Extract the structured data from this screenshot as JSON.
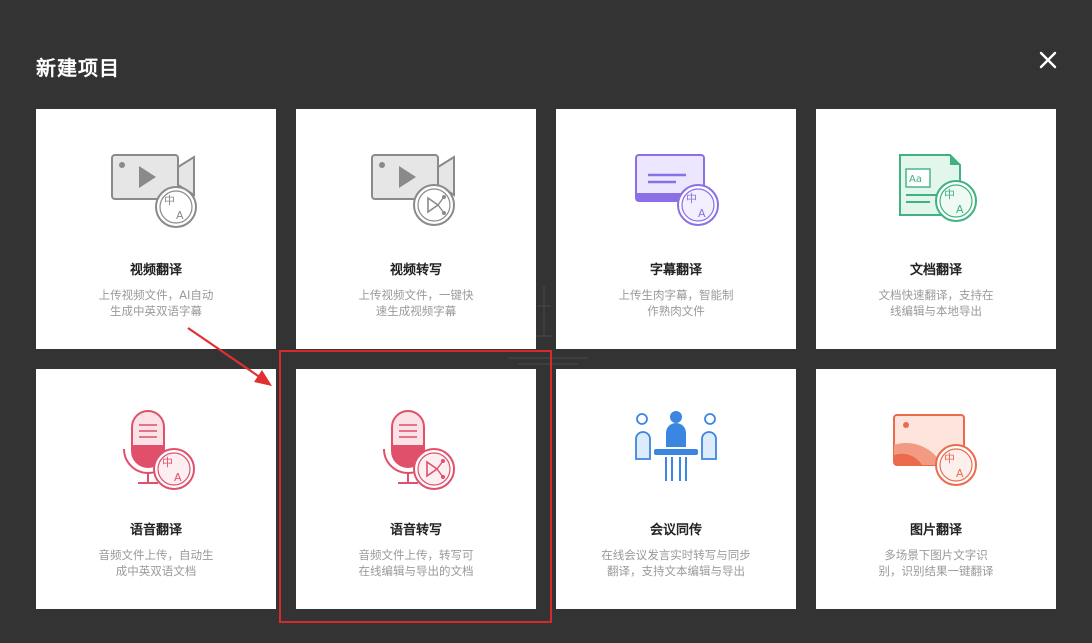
{
  "dialog": {
    "title": "新建项目",
    "close_icon": "close-icon"
  },
  "cards": [
    {
      "name": "视频翻译",
      "desc": [
        "上传视频文件，AI自动",
        "生成中英双语字幕"
      ],
      "icon": "video-translate-icon"
    },
    {
      "name": "视频转写",
      "desc": [
        "上传视频文件，一键快",
        "速生成视频字幕"
      ],
      "icon": "video-transcribe-icon"
    },
    {
      "name": "字幕翻译",
      "desc": [
        "上传生肉字幕，智能制",
        "作熟肉文件"
      ],
      "icon": "subtitle-translate-icon"
    },
    {
      "name": "文档翻译",
      "desc": [
        "文档快速翻译，支持在",
        "线编辑与本地导出"
      ],
      "icon": "document-translate-icon"
    },
    {
      "name": "语音翻译",
      "desc": [
        "音频文件上传，自动生",
        "成中英双语文档"
      ],
      "icon": "audio-translate-icon"
    },
    {
      "name": "语音转写",
      "desc": [
        "音频文件上传，转写可",
        "在线编辑与导出的文档"
      ],
      "icon": "audio-transcribe-icon"
    },
    {
      "name": "会议同传",
      "desc": [
        "在线会议发言实时转写与同步",
        "翻译，支持文本编辑与导出"
      ],
      "icon": "meeting-interpret-icon"
    },
    {
      "name": "图片翻译",
      "desc": [
        "多场景下图片文字识",
        "别，识别结果一键翻译"
      ],
      "icon": "image-translate-icon"
    }
  ],
  "annotation": {
    "highlight_color": "#d42a2a",
    "highlighted_card": "语音转写"
  },
  "colors": {
    "overlay": "#333333",
    "card": "#ffffff",
    "video": "#8a8a8a",
    "subtitle": "#8b6fe6",
    "document": "#3fb27f",
    "audio": "#e0506a",
    "meeting": "#3a86e0",
    "image": "#ec6a4c"
  }
}
